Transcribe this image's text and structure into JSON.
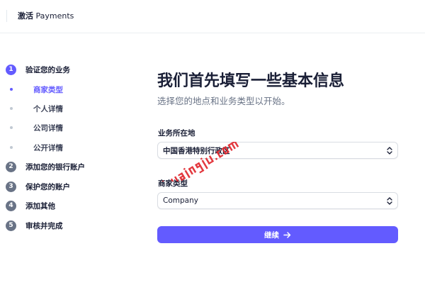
{
  "header": {
    "prefix": "激活",
    "brand": "Payments"
  },
  "sidebar": {
    "steps": [
      {
        "number": "1",
        "label": "验证您的业务"
      },
      {
        "number": "2",
        "label": "添加您的银行账户"
      },
      {
        "number": "3",
        "label": "保护您的账户"
      },
      {
        "number": "4",
        "label": "添加其他"
      },
      {
        "number": "5",
        "label": "审核并完成"
      }
    ],
    "substeps": [
      {
        "label": "商家类型"
      },
      {
        "label": "个人详情"
      },
      {
        "label": "公司详情"
      },
      {
        "label": "公开详情"
      }
    ]
  },
  "main": {
    "heading": "我们首先填写一些基本信息",
    "subheading": "选择您的地点和业务类型以开始。",
    "business_location": {
      "label": "业务所在地",
      "value": "中国香港特别行政区"
    },
    "business_type": {
      "label": "商家类型",
      "value": "Company"
    },
    "continue_label": "继续"
  },
  "watermark": {
    "text": "kuajingju.com",
    "color": "#e0242b"
  },
  "colors": {
    "accent": "#635bff",
    "step_inactive": "#697386",
    "text": "#1a1f36"
  }
}
